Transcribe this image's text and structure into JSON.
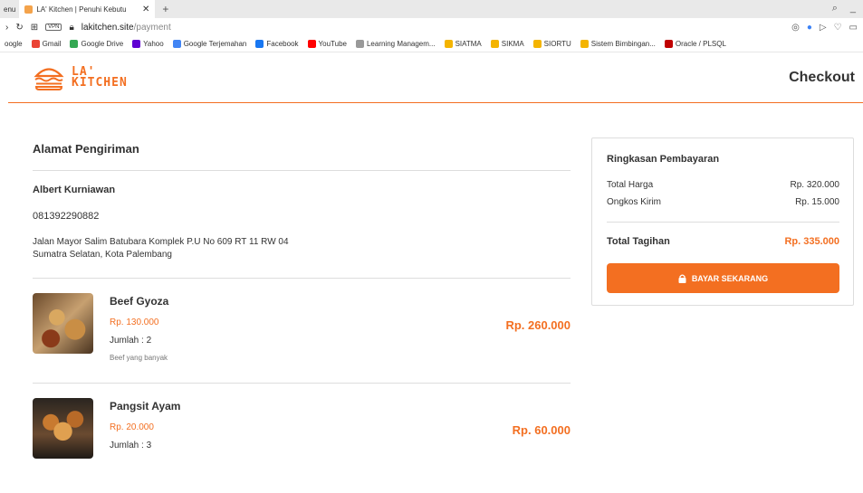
{
  "browser": {
    "menu_label": "enu",
    "tab_title": "LA' Kitchen | Penuhi Kebutu",
    "vpn": "VPN",
    "url_host": "lakitchen.site",
    "url_path": "/payment",
    "bookmarks": [
      {
        "label": "oogle",
        "color": "#4285f4"
      },
      {
        "label": "Gmail",
        "color": "#ea4335"
      },
      {
        "label": "Google Drive",
        "color": "#34a853"
      },
      {
        "label": "Yahoo",
        "color": "#6001d2"
      },
      {
        "label": "Google Terjemahan",
        "color": "#4285f4"
      },
      {
        "label": "Facebook",
        "color": "#1877f2"
      },
      {
        "label": "YouTube",
        "color": "#ff0000"
      },
      {
        "label": "Learning Managem...",
        "color": "#999999"
      },
      {
        "label": "SIATMA",
        "color": "#f4b400"
      },
      {
        "label": "SIKMA",
        "color": "#f4b400"
      },
      {
        "label": "SIORTU",
        "color": "#f4b400"
      },
      {
        "label": "Sistem Bimbingan...",
        "color": "#f4b400"
      },
      {
        "label": "Oracle / PLSQL",
        "color": "#c00000"
      }
    ]
  },
  "header": {
    "logo_line1": "LA'",
    "logo_line2": "KITCHEN",
    "title": "Checkout"
  },
  "shipping": {
    "title": "Alamat Pengiriman",
    "name": "Albert Kurniawan",
    "phone": "081392290882",
    "address_line1": "Jalan Mayor Salim Batubara Komplek P.U No 609 RT 11 RW 04",
    "address_line2": "Sumatra Selatan, Kota Palembang"
  },
  "items": [
    {
      "name": "Beef Gyoza",
      "price": "Rp. 130.000",
      "qty": "Jumlah : 2",
      "note": "Beef yang banyak",
      "total": "Rp. 260.000"
    },
    {
      "name": "Pangsit Ayam",
      "price": "Rp. 20.000",
      "qty": "Jumlah : 3",
      "note": "",
      "total": "Rp. 60.000"
    }
  ],
  "summary": {
    "title": "Ringkasan Pembayaran",
    "total_price_label": "Total Harga",
    "total_price_value": "Rp. 320.000",
    "shipping_label": "Ongkos Kirim",
    "shipping_value": "Rp. 15.000",
    "bill_label": "Total Tagihan",
    "bill_value": "Rp. 335.000",
    "pay_button": "BAYAR SEKARANG"
  },
  "colors": {
    "accent": "#f36f21"
  }
}
